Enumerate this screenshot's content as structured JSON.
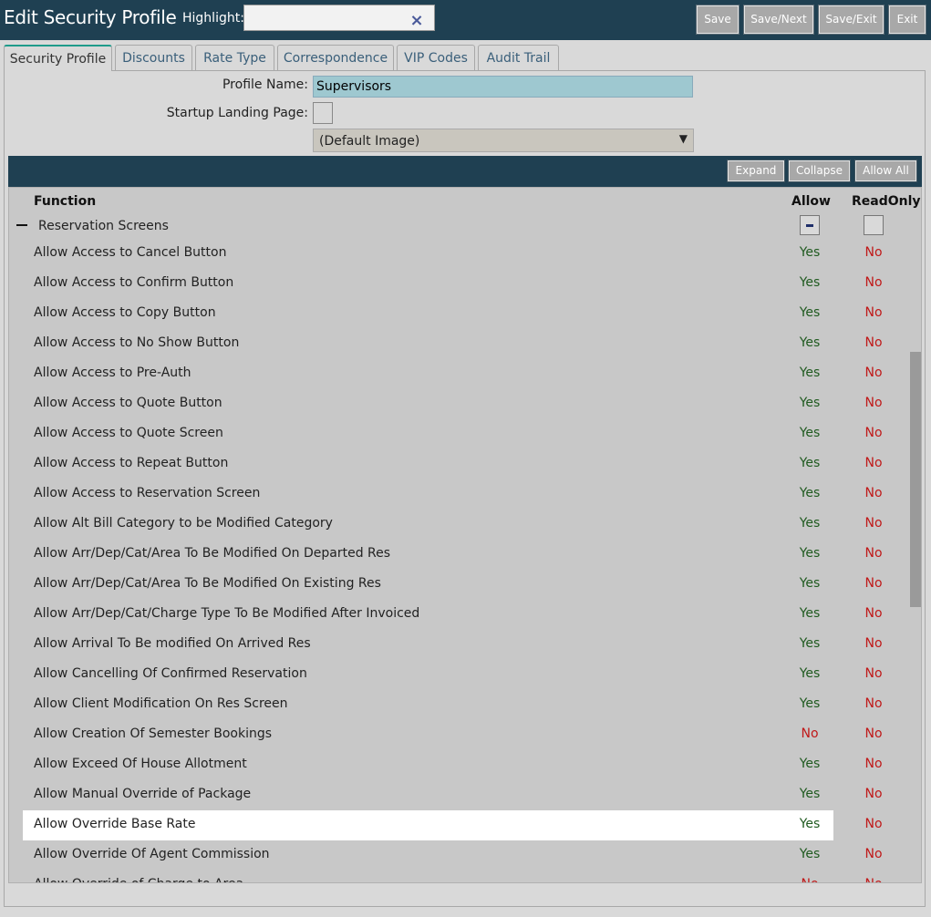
{
  "header": {
    "title": "Edit Security Profile",
    "highlight_label": "Highlight:",
    "highlight_value": "",
    "clear_icon": "×",
    "buttons": {
      "save": "Save",
      "save_next": "Save/Next",
      "save_exit": "Save/Exit",
      "exit": "Exit"
    }
  },
  "tabs": [
    {
      "label": "Security Profile",
      "active": true
    },
    {
      "label": "Discounts"
    },
    {
      "label": "Rate Type"
    },
    {
      "label": "Correspondence"
    },
    {
      "label": "VIP Codes"
    },
    {
      "label": "Audit Trail"
    }
  ],
  "form": {
    "profile_name_label": "Profile Name:",
    "profile_name_value": "Supervisors",
    "landing_label": "Startup Landing Page:",
    "image_select": "(Default Image)"
  },
  "grid": {
    "buttons": {
      "expand": "Expand",
      "collapse": "Collapse",
      "allow_all": "Allow All"
    },
    "headers": {
      "function": "Function",
      "allow": "Allow",
      "readonly": "ReadOnly"
    },
    "group": {
      "label": "Reservation Screens",
      "allow_state": "partial",
      "readonly_state": "unchecked"
    },
    "rows": [
      {
        "fn": "Allow Access to Cancel Button",
        "allow": "Yes",
        "readonly": "No"
      },
      {
        "fn": "Allow Access to Confirm Button",
        "allow": "Yes",
        "readonly": "No"
      },
      {
        "fn": "Allow Access to Copy Button",
        "allow": "Yes",
        "readonly": "No"
      },
      {
        "fn": "Allow Access to No Show Button",
        "allow": "Yes",
        "readonly": "No"
      },
      {
        "fn": "Allow Access to Pre-Auth",
        "allow": "Yes",
        "readonly": "No"
      },
      {
        "fn": "Allow Access to Quote Button",
        "allow": "Yes",
        "readonly": "No"
      },
      {
        "fn": "Allow Access to Quote Screen",
        "allow": "Yes",
        "readonly": "No"
      },
      {
        "fn": "Allow Access to Repeat Button",
        "allow": "Yes",
        "readonly": "No"
      },
      {
        "fn": "Allow Access to Reservation Screen",
        "allow": "Yes",
        "readonly": "No"
      },
      {
        "fn": "Allow Alt Bill Category to be Modified Category",
        "allow": "Yes",
        "readonly": "No"
      },
      {
        "fn": "Allow Arr/Dep/Cat/Area To Be Modified On Departed Res",
        "allow": "Yes",
        "readonly": "No"
      },
      {
        "fn": "Allow Arr/Dep/Cat/Area To Be Modified On Existing Res",
        "allow": "Yes",
        "readonly": "No"
      },
      {
        "fn": "Allow Arr/Dep/Cat/Charge Type To Be Modified After Invoiced",
        "allow": "Yes",
        "readonly": "No"
      },
      {
        "fn": "Allow Arrival To Be modified On Arrived Res",
        "allow": "Yes",
        "readonly": "No"
      },
      {
        "fn": "Allow Cancelling Of Confirmed Reservation",
        "allow": "Yes",
        "readonly": "No"
      },
      {
        "fn": "Allow Client Modification On Res Screen",
        "allow": "Yes",
        "readonly": "No"
      },
      {
        "fn": "Allow Creation Of Semester Bookings",
        "allow": "No",
        "readonly": "No"
      },
      {
        "fn": "Allow Exceed Of House Allotment",
        "allow": "Yes",
        "readonly": "No"
      },
      {
        "fn": "Allow Manual Override of Package",
        "allow": "Yes",
        "readonly": "No"
      },
      {
        "fn": "Allow Override Base Rate",
        "allow": "Yes",
        "readonly": "No",
        "highlighted": true
      },
      {
        "fn": "Allow Override Of Agent Commission",
        "allow": "Yes",
        "readonly": "No"
      },
      {
        "fn": "Allow Override of Charge to Area",
        "allow": "No",
        "readonly": "No"
      }
    ]
  }
}
